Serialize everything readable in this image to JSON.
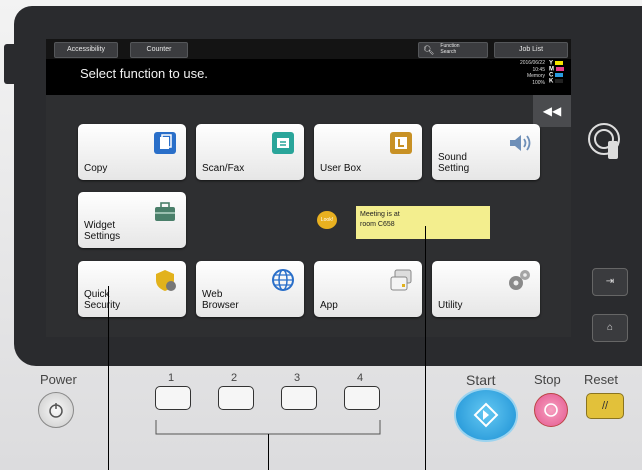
{
  "topbar": {
    "accessibility_label": "Accessibility",
    "counter_label": "Counter",
    "function_search_label": "Function\nSearch",
    "job_list_label": "Job List"
  },
  "message": "Select function to use.",
  "status": {
    "date": "2016/06/22",
    "time": "10:45",
    "memory_label": "Memory",
    "memory_value": "100%",
    "toner": [
      {
        "letter": "Y",
        "color": "#f5e400"
      },
      {
        "letter": "M",
        "color": "#e83e8c"
      },
      {
        "letter": "C",
        "color": "#2a9be0"
      },
      {
        "letter": "K",
        "color": "#222222"
      }
    ]
  },
  "tiles": {
    "copy": "Copy",
    "scan_fax": "Scan/Fax",
    "user_box": "User Box",
    "sound_setting": "Sound\nSetting",
    "widget_settings": "Widget\nSettings",
    "quick_security": "Quick\nSecurity",
    "web_browser": "Web\nBrowser",
    "app": "App",
    "utility": "Utility"
  },
  "sticky_note": "Meeting is at\nroom C658",
  "widget_icon_label": "Look!",
  "hardware": {
    "power": "Power",
    "start": "Start",
    "stop": "Stop",
    "reset": "Reset",
    "keys": [
      "1",
      "2",
      "3",
      "4"
    ]
  },
  "colors": {
    "screen_bg": "#2e2f31",
    "tile_bg": "#ffffff",
    "start": "#1a8fd4",
    "stop": "#e4578f",
    "reset": "#e2c13a",
    "sticky": "#f3ee8e"
  }
}
